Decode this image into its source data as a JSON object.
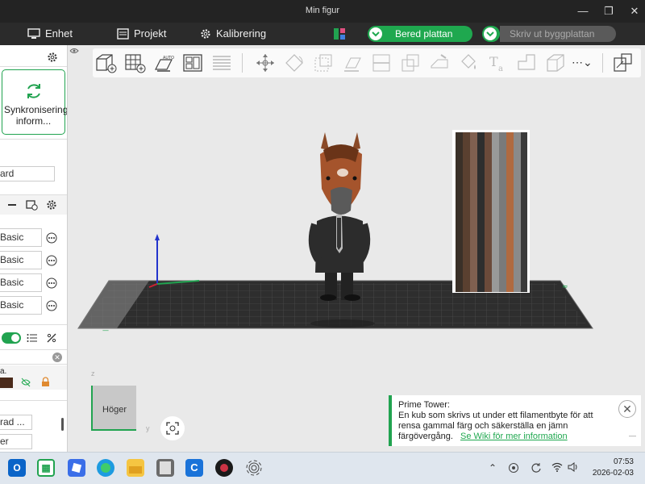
{
  "window": {
    "title": "Min figur"
  },
  "menu": {
    "device": "Enhet",
    "project": "Projekt",
    "calibration": "Kalibrering",
    "prepare": "Bered plattan",
    "print": "Skriv ut byggplattan"
  },
  "sidebar": {
    "sync_label": "Synkroniserings inform...",
    "field_ard": "ard",
    "filaments": [
      "Basic",
      "Basic",
      "Basic",
      "Basic"
    ],
    "plate_label": "a.",
    "field_rad": "rad ...",
    "field_er": "er"
  },
  "viewport": {
    "cube_label": "Höger",
    "axis_z": "z",
    "axis_y": "y"
  },
  "notification": {
    "title": "Prime Tower:",
    "body": "En kub som skrivs ut under ett filamentbyte för att rensa gammal färg och säkerställa en jämn färgövergång.",
    "link": "Se Wiki för mer information"
  },
  "taskbar": {
    "time": "07:53",
    "date": "2026-02-03"
  },
  "colors": {
    "accent": "#21a350",
    "titlebar": "#232323",
    "menubar": "#2b2b2b"
  }
}
